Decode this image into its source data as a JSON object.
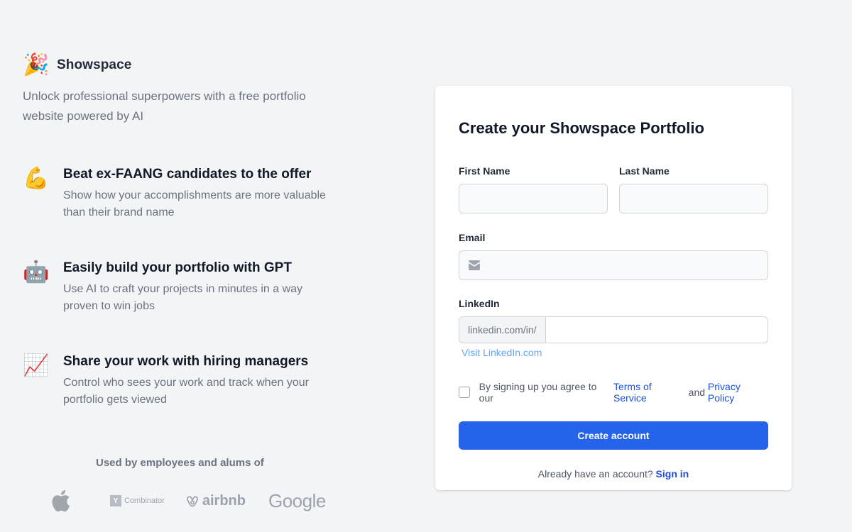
{
  "brand": {
    "name": "Showspace",
    "icon": "party-popper-icon"
  },
  "tagline": "Unlock professional superpowers with a free portfolio website powered by AI",
  "features": [
    {
      "icon": "flexed-biceps-icon",
      "emoji": "💪",
      "title": "Beat ex-FAANG candidates to the offer",
      "description": "Show how your accomplishments are more valuable than their brand name"
    },
    {
      "icon": "robot-icon",
      "emoji": "🤖",
      "title": "Easily build your portfolio with GPT",
      "description": "Use AI to craft your projects in minutes in a way proven to win jobs"
    },
    {
      "icon": "chart-increasing-icon",
      "emoji": "📈",
      "title": "Share your work with hiring managers",
      "description": "Control who sees your work and track when your portfolio gets viewed"
    }
  ],
  "used_by": {
    "label": "Used by employees and alums of",
    "logos": {
      "yc_letter": "Y",
      "yc_name": "Combinator",
      "airbnb": "airbnb",
      "google": "Google"
    }
  },
  "form": {
    "title": "Create your Showspace Portfolio",
    "first_name_label": "First Name",
    "last_name_label": "Last Name",
    "email_label": "Email",
    "linkedin_label": "LinkedIn",
    "linkedin_prefix": "linkedin.com/in/",
    "visit_link": "Visit LinkedIn.com",
    "terms": {
      "prefix": "By signing up you agree to our",
      "tos": "Terms of Service",
      "and": "and",
      "privacy": "Privacy Policy"
    },
    "submit_label": "Create account",
    "signin_prompt": "Already have an account?",
    "signin_link": "Sign in"
  },
  "colors": {
    "accent": "#2563eb",
    "link": "#1d4ed8",
    "background": "#f3f4f6"
  }
}
